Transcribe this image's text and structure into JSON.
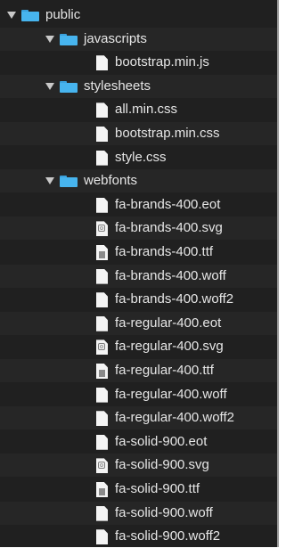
{
  "tree": {
    "rows": [
      {
        "label": "public",
        "type": "folder",
        "expanded": true,
        "depth": 0
      },
      {
        "label": "javascripts",
        "type": "folder",
        "expanded": true,
        "depth": 1
      },
      {
        "label": "bootstrap.min.js",
        "type": "file",
        "icon": "document-icon",
        "depth": 2
      },
      {
        "label": "stylesheets",
        "type": "folder",
        "expanded": true,
        "depth": 1
      },
      {
        "label": "all.min.css",
        "type": "file",
        "icon": "document-icon",
        "depth": 2
      },
      {
        "label": "bootstrap.min.css",
        "type": "file",
        "icon": "document-icon",
        "depth": 2
      },
      {
        "label": "style.css",
        "type": "file",
        "icon": "document-icon",
        "depth": 2
      },
      {
        "label": "webfonts",
        "type": "folder",
        "expanded": true,
        "depth": 1
      },
      {
        "label": "fa-brands-400.eot",
        "type": "file",
        "icon": "document-icon",
        "depth": 2
      },
      {
        "label": "fa-brands-400.svg",
        "type": "file",
        "icon": "svg-image-icon",
        "depth": 2
      },
      {
        "label": "fa-brands-400.ttf",
        "type": "file",
        "icon": "font-file-icon",
        "depth": 2
      },
      {
        "label": "fa-brands-400.woff",
        "type": "file",
        "icon": "document-icon",
        "depth": 2
      },
      {
        "label": "fa-brands-400.woff2",
        "type": "file",
        "icon": "document-icon",
        "depth": 2
      },
      {
        "label": "fa-regular-400.eot",
        "type": "file",
        "icon": "document-icon",
        "depth": 2
      },
      {
        "label": "fa-regular-400.svg",
        "type": "file",
        "icon": "svg-image-icon",
        "depth": 2
      },
      {
        "label": "fa-regular-400.ttf",
        "type": "file",
        "icon": "font-file-icon",
        "depth": 2
      },
      {
        "label": "fa-regular-400.woff",
        "type": "file",
        "icon": "document-icon",
        "depth": 2
      },
      {
        "label": "fa-regular-400.woff2",
        "type": "file",
        "icon": "document-icon",
        "depth": 2
      },
      {
        "label": "fa-solid-900.eot",
        "type": "file",
        "icon": "document-icon",
        "depth": 2
      },
      {
        "label": "fa-solid-900.svg",
        "type": "file",
        "icon": "svg-image-icon",
        "depth": 2
      },
      {
        "label": "fa-solid-900.ttf",
        "type": "file",
        "icon": "font-file-icon",
        "depth": 2
      },
      {
        "label": "fa-solid-900.woff",
        "type": "file",
        "icon": "document-icon",
        "depth": 2
      },
      {
        "label": "fa-solid-900.woff2",
        "type": "file",
        "icon": "document-icon",
        "depth": 2
      }
    ]
  },
  "colors": {
    "background": "#202020",
    "folder": "#47b4ee",
    "text": "#e6e6e6"
  }
}
